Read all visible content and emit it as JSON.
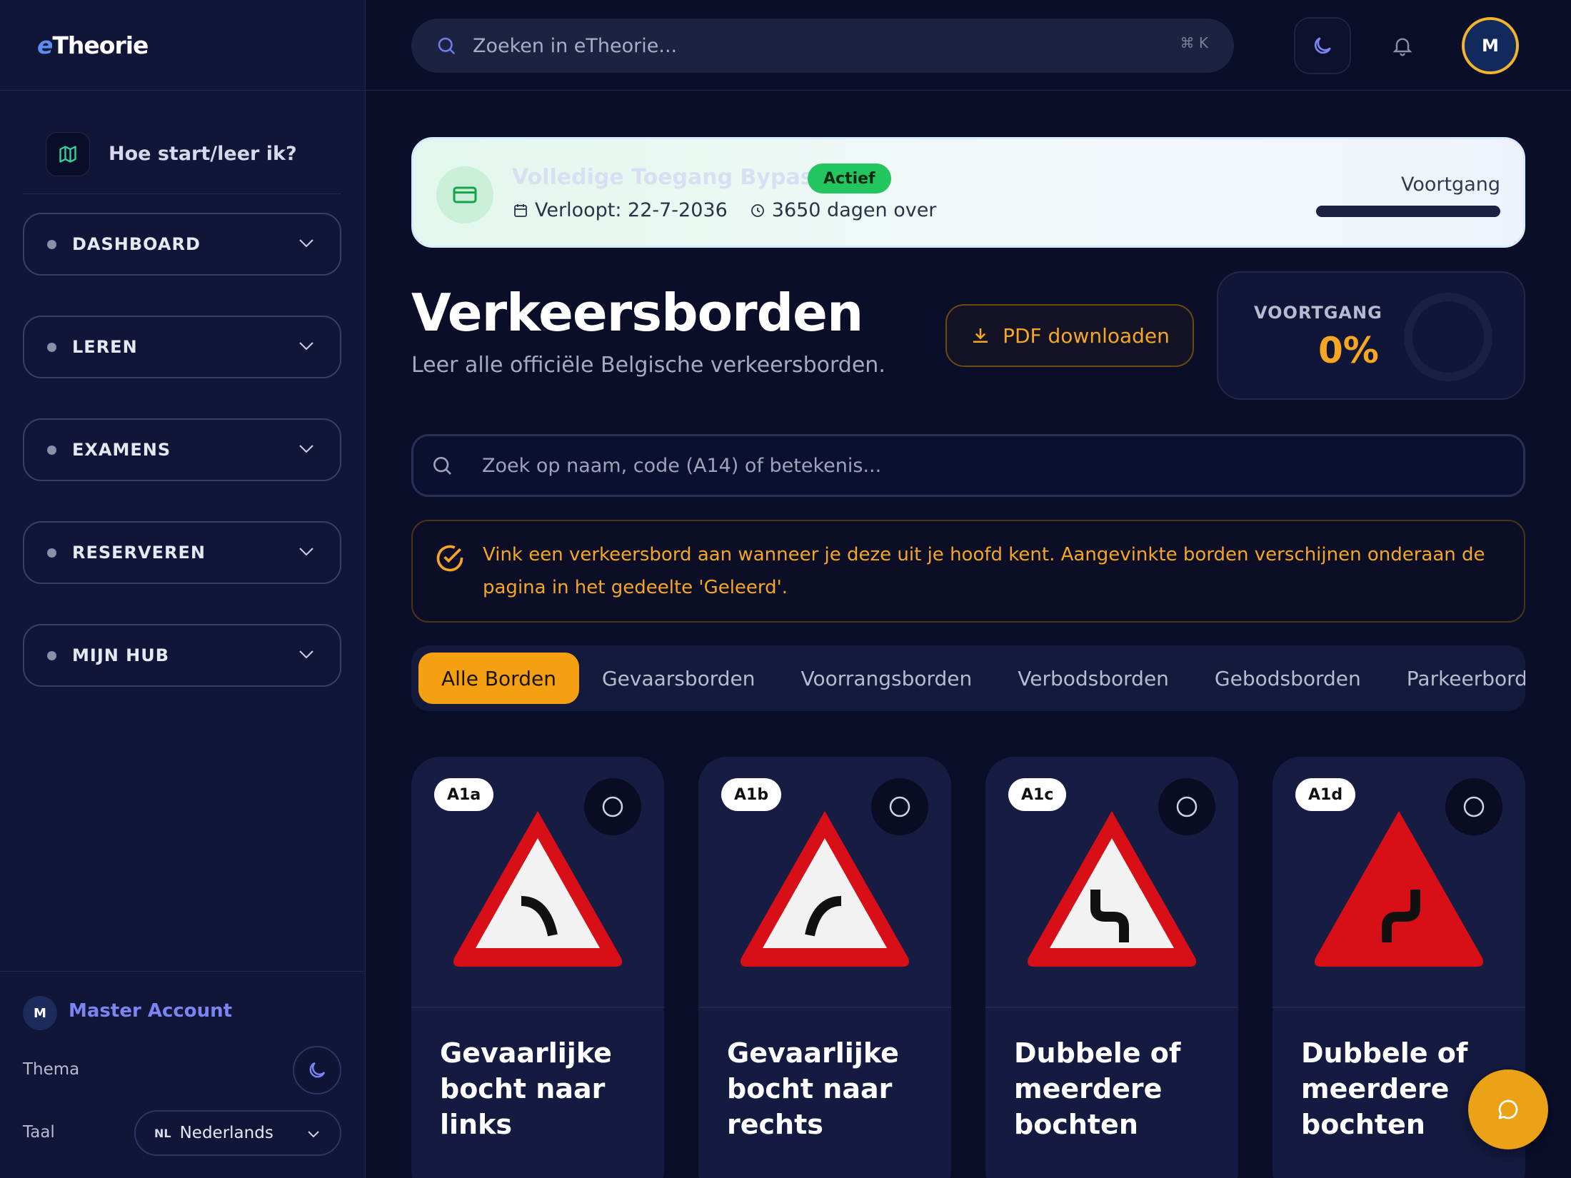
{
  "app": {
    "logo_prefix": "e",
    "logo_name": "Theorie"
  },
  "sidebar": {
    "howto_label": "Hoe start/leer ik?",
    "nav": [
      {
        "label": "DASHBOARD"
      },
      {
        "label": "LEREN"
      },
      {
        "label": "EXAMENS"
      },
      {
        "label": "RESERVEREN"
      },
      {
        "label": "MIJN HUB"
      }
    ],
    "account_initial": "M",
    "account_name": "Master Account",
    "theme_label": "Thema",
    "language_label": "Taal",
    "language_code": "NL",
    "language_name": "Nederlands"
  },
  "topbar": {
    "search_placeholder": "Zoeken in eTheorie...",
    "search_shortcut": "⌘ K",
    "avatar_initial": "M"
  },
  "subscription": {
    "title": "Volledige Toegang Bypass",
    "status_badge": "Actief",
    "expires": "Verloopt: 22-7-2036",
    "days_left": "3650 dagen over",
    "progress_label": "Voortgang",
    "progress_fraction": 1.0
  },
  "page": {
    "title": "Verkeersborden",
    "subtitle": "Leer alle officiële Belgische verkeersborden.",
    "pdf_button": "PDF downloaden",
    "progress_card_label": "VOORTGANG",
    "progress_card_value": "0%",
    "progress_percent": 0,
    "filter_placeholder": "Zoek op naam, code (A14) of betekenis...",
    "notice": "Vink een verkeersbord aan wanneer je deze uit je hoofd kent. Aangevinkte borden verschijnen onderaan de pagina in het gedeelte 'Geleerd'."
  },
  "tabs": [
    {
      "label": "Alle Borden",
      "active": true
    },
    {
      "label": "Gevaarsborden",
      "active": false
    },
    {
      "label": "Voorrangsborden",
      "active": false
    },
    {
      "label": "Verbodsborden",
      "active": false
    },
    {
      "label": "Gebodsborden",
      "active": false
    },
    {
      "label": "Parkeerborden",
      "active": false
    }
  ],
  "cards": [
    {
      "code": "A1a",
      "name": "Gevaarlijke bocht naar links",
      "sign_icon": "curve-left-icon"
    },
    {
      "code": "A1b",
      "name": "Gevaarlijke bocht naar rechts",
      "sign_icon": "curve-right-icon"
    },
    {
      "code": "A1c",
      "name": "Dubbele of meerdere bochten",
      "sign_icon": "double-curve-left-icon"
    },
    {
      "code": "A1d",
      "name": "Dubbele of meerdere bochten",
      "sign_icon": "double-curve-right-icon"
    }
  ],
  "colors": {
    "accent": "#f5a623",
    "success": "#22c55e",
    "background": "#0a0e29",
    "sidebar": "#111538",
    "sign_red": "#d90f17"
  }
}
